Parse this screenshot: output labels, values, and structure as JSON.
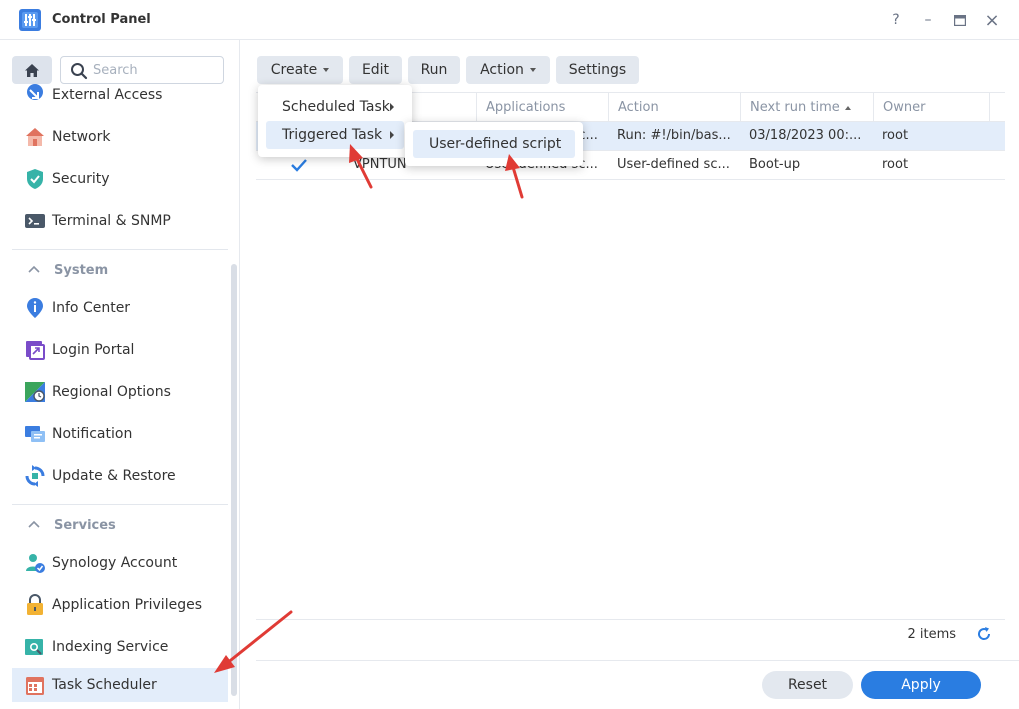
{
  "window": {
    "title": "Control Panel",
    "help": "?",
    "minimize": "–",
    "maximize": "□",
    "close": "×"
  },
  "sidebar": {
    "search_placeholder": "Search",
    "items_top": [
      {
        "label": "External Access",
        "icon": "external-access-icon"
      },
      {
        "label": "Network",
        "icon": "network-icon"
      },
      {
        "label": "Security",
        "icon": "shield-icon"
      },
      {
        "label": "Terminal & SNMP",
        "icon": "terminal-icon"
      }
    ],
    "section_system": "System",
    "items_system": [
      {
        "label": "Info Center",
        "icon": "info-icon"
      },
      {
        "label": "Login Portal",
        "icon": "login-portal-icon"
      },
      {
        "label": "Regional Options",
        "icon": "regional-options-icon"
      },
      {
        "label": "Notification",
        "icon": "notification-icon"
      },
      {
        "label": "Update & Restore",
        "icon": "update-restore-icon"
      }
    ],
    "section_services": "Services",
    "items_services": [
      {
        "label": "Synology Account",
        "icon": "synology-account-icon"
      },
      {
        "label": "Application Privileges",
        "icon": "lock-icon"
      },
      {
        "label": "Indexing Service",
        "icon": "indexing-icon"
      },
      {
        "label": "Task Scheduler",
        "icon": "calendar-icon",
        "active": true
      }
    ]
  },
  "toolbar": {
    "create": "Create",
    "edit": "Edit",
    "run": "Run",
    "action": "Action",
    "settings": "Settings"
  },
  "grid": {
    "columns": [
      "Applications",
      "Action",
      "Next run time",
      "Owner"
    ],
    "rows": [
      {
        "enabled": true,
        "name": "",
        "applications": "User-defined sc...",
        "action": "Run: #!/bin/bas...",
        "next_run": "03/18/2023 00:...",
        "owner": "root"
      },
      {
        "enabled": true,
        "name": "VPNTUN",
        "applications": "User-defined sc...",
        "action": "User-defined sc...",
        "next_run": "Boot-up",
        "owner": "root"
      }
    ],
    "count_label": "2 items"
  },
  "create_menu": {
    "items": [
      "Scheduled Task",
      "Triggered Task"
    ]
  },
  "submenu": {
    "items": [
      "User-defined script"
    ]
  },
  "footer": {
    "reset": "Reset",
    "apply": "Apply"
  },
  "colors": {
    "accent": "#2a7de1",
    "selection": "#e3edfa",
    "annotation_arrow": "#e03b35"
  }
}
